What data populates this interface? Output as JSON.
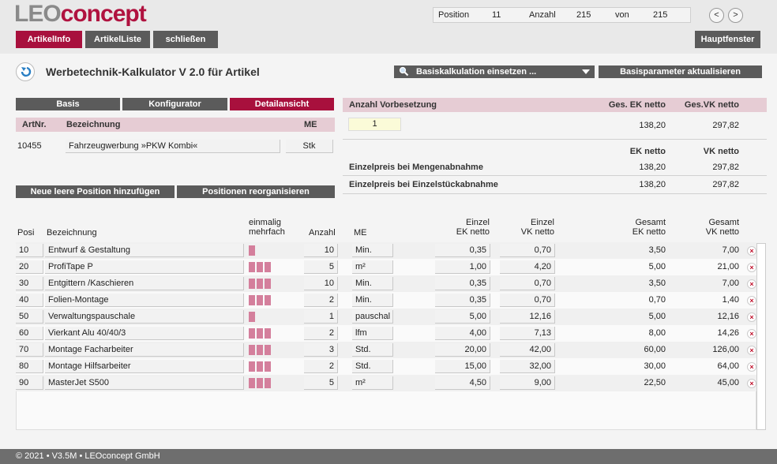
{
  "logo": {
    "part1": "LEO",
    "part2": "concept"
  },
  "position": {
    "pos_label": "Position",
    "pos_value": "11",
    "count_label": "Anzahl",
    "count_value": "215",
    "of_label": "von",
    "of_value": "215"
  },
  "nav": {
    "prev": "<",
    "next": ">"
  },
  "tabs": {
    "artikelinfo": "ArtikelInfo",
    "artikelliste": "ArtikelListe",
    "schliessen": "schließen",
    "hauptfenster": "Hauptfenster"
  },
  "page": {
    "title": "Werbetechnik-Kalkulator V 2.0 für Artikel",
    "dropdown": "Basiskalkulation einsetzen ...",
    "update_btn": "Basisparameter aktualisieren"
  },
  "subtabs": {
    "basis": "Basis",
    "konfigurator": "Konfigurator",
    "detail": "Detailansicht"
  },
  "article": {
    "hdr_nr": "ArtNr.",
    "hdr_bez": "Bezeichnung",
    "hdr_me": "ME",
    "nr": "10455",
    "bez": "Fahrzeugwerbung »PKW Kombi«",
    "me": "Stk"
  },
  "buttons": {
    "add": "Neue leere Position hinzufügen",
    "reorg": "Positionen reorganisieren"
  },
  "summary": {
    "hdr_anzahl": "Anzahl Vorbesetzung",
    "hdr_ek": "Ges. EK netto",
    "hdr_vk": "Ges.VK netto",
    "anzahl": "1",
    "ges_ek": "138,20",
    "ges_vk": "297,82",
    "ek_label": "EK netto",
    "vk_label": "VK netto",
    "menge_label": "Einzelpreis bei Mengenabnahme",
    "menge_ek": "138,20",
    "menge_vk": "297,82",
    "stueck_label": "Einzelpreis bei Einzelstückabnahme",
    "stueck_ek": "138,20",
    "stueck_vk": "297,82"
  },
  "table": {
    "headers": {
      "posi": "Posi",
      "bez": "Bezeichnung",
      "einmalig": "einmalig",
      "mehrfach": "mehrfach",
      "anzahl": "Anzahl",
      "me": "ME",
      "einzel1": "Einzel",
      "eknetto": "EK netto",
      "einzel2": "Einzel",
      "vknetto": "VK netto",
      "gesamt1": "Gesamt",
      "gesek": "EK netto",
      "gesamt2": "Gesamt",
      "gesvk": "VK netto"
    },
    "rows": [
      {
        "posi": "10",
        "bez": "Entwurf & Gestaltung",
        "bars": 1,
        "anzahl": "10",
        "me": "Min.",
        "ek": "0,35",
        "vk": "0,70",
        "gek": "3,50",
        "gvk": "7,00"
      },
      {
        "posi": "20",
        "bez": "ProfiTape P",
        "bars": 3,
        "anzahl": "5",
        "me": "m²",
        "ek": "1,00",
        "vk": "4,20",
        "gek": "5,00",
        "gvk": "21,00"
      },
      {
        "posi": "30",
        "bez": "Entgittern /Kaschieren",
        "bars": 3,
        "anzahl": "10",
        "me": "Min.",
        "ek": "0,35",
        "vk": "0,70",
        "gek": "3,50",
        "gvk": "7,00"
      },
      {
        "posi": "40",
        "bez": "Folien-Montage",
        "bars": 3,
        "anzahl": "2",
        "me": "Min.",
        "ek": "0,35",
        "vk": "0,70",
        "gek": "0,70",
        "gvk": "1,40"
      },
      {
        "posi": "50",
        "bez": "Verwaltungspauschale",
        "bars": 1,
        "anzahl": "1",
        "me": "pauschal",
        "ek": "5,00",
        "vk": "12,16",
        "gek": "5,00",
        "gvk": "12,16"
      },
      {
        "posi": "60",
        "bez": "Vierkant Alu 40/40/3",
        "bars": 3,
        "anzahl": "2",
        "me": "lfm",
        "ek": "4,00",
        "vk": "7,13",
        "gek": "8,00",
        "gvk": "14,26"
      },
      {
        "posi": "70",
        "bez": "Montage Facharbeiter",
        "bars": 3,
        "anzahl": "3",
        "me": "Std.",
        "ek": "20,00",
        "vk": "42,00",
        "gek": "60,00",
        "gvk": "126,00"
      },
      {
        "posi": "80",
        "bez": "Montage Hilfsarbeiter",
        "bars": 3,
        "anzahl": "2",
        "me": "Std.",
        "ek": "15,00",
        "vk": "32,00",
        "gek": "30,00",
        "gvk": "64,00"
      },
      {
        "posi": "90",
        "bez": "MasterJet S500",
        "bars": 3,
        "anzahl": "5",
        "me": "m²",
        "ek": "4,50",
        "vk": "9,00",
        "gek": "22,50",
        "gvk": "45,00"
      }
    ]
  },
  "footer": {
    "text": "© 2021 • V3.5M • LEOconcept GmbH"
  },
  "colors": {
    "brand": "#a8103d",
    "dark": "#5b5b5b",
    "pink": "#e6ccd4",
    "bar": "#d47f9c"
  }
}
